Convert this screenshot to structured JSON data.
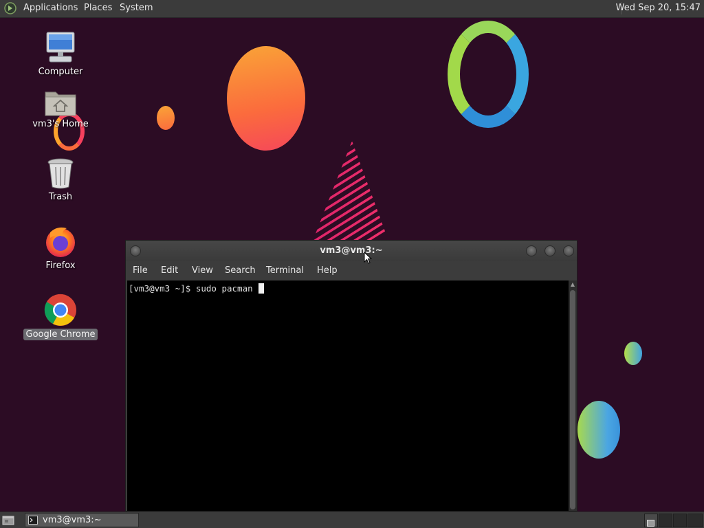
{
  "top_panel": {
    "menus": [
      "Applications",
      "Places",
      "System"
    ],
    "clock": "Wed Sep 20, 15:47"
  },
  "desktop_icons": [
    {
      "label": "Computer",
      "icon": "computer-icon",
      "selected": false
    },
    {
      "label": "vm3's Home",
      "icon": "home-folder-icon",
      "selected": false
    },
    {
      "label": "Trash",
      "icon": "trash-icon",
      "selected": false
    },
    {
      "label": "Firefox",
      "icon": "firefox-icon",
      "selected": false
    },
    {
      "label": "Google Chrome",
      "icon": "chrome-icon",
      "selected": true
    }
  ],
  "terminal": {
    "title": "vm3@vm3:~",
    "menus": [
      "File",
      "Edit",
      "View",
      "Search",
      "Terminal",
      "Help"
    ],
    "prompt": "[vm3@vm3 ~]$ ",
    "command": "sudo pacman "
  },
  "taskbar": {
    "window_label": "vm3@vm3:~",
    "window_icon": "terminal-icon"
  },
  "colors": {
    "wallpaper": "#2c0c24",
    "panel": "#3b3b3b",
    "terminal_bg": "#000000",
    "selected_label": "#6b6b70"
  }
}
